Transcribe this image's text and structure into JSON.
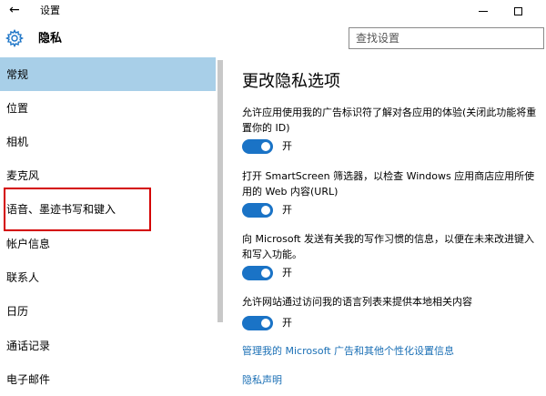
{
  "titlebar": {
    "back_icon": "←",
    "app_title": "设置"
  },
  "header": {
    "page_title": "隐私",
    "search_placeholder": "查找设置"
  },
  "sidebar": {
    "items": [
      {
        "label": "常规",
        "selected": true
      },
      {
        "label": "位置"
      },
      {
        "label": "相机"
      },
      {
        "label": "麦克风"
      },
      {
        "label": "语音、墨迹书写和键入",
        "highlighted": true
      },
      {
        "label": "帐户信息"
      },
      {
        "label": "联系人"
      },
      {
        "label": "日历"
      },
      {
        "label": "通话记录"
      },
      {
        "label": "电子邮件"
      }
    ]
  },
  "main": {
    "title": "更改隐私选项",
    "options": [
      {
        "text": "允许应用使用我的广告标识符了解对各应用的体验(关闭此功能将重置你的 ID)",
        "state": "开"
      },
      {
        "text": "打开 SmartScreen 筛选器，以检查 Windows 应用商店应用所使用的 Web 内容(URL)",
        "state": "开"
      },
      {
        "text": "向 Microsoft 发送有关我的写作习惯的信息，以便在未来改进键入和写入功能。",
        "state": "开"
      },
      {
        "text": "允许网站通过访问我的语言列表来提供本地相关内容",
        "state": "开"
      }
    ],
    "link_manage": "管理我的 Microsoft 广告和其他个性化设置信息",
    "link_privacy": "隐私声明"
  },
  "colors": {
    "accent": "#1a73c6",
    "selected_bg": "#a8cfe8",
    "highlight_border": "#d40000",
    "link": "#1a6fb5"
  }
}
